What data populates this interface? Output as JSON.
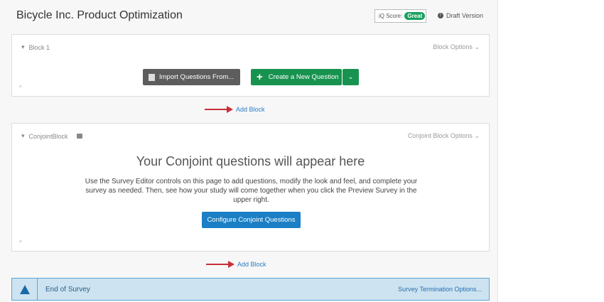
{
  "header": {
    "title": "Bicycle Inc. Product Optimization",
    "iq_label": "iQ Score:",
    "iq_value": "Great",
    "draft": "Draft Version"
  },
  "block1": {
    "name": "Block 1",
    "options": "Block Options",
    "import": "Import Questions From...",
    "create": "Create a New Question"
  },
  "add_block": "Add Block",
  "conjoint": {
    "name": "ConjointBlock",
    "options": "Conjoint Block Options",
    "heading": "Your Conjoint questions will appear here",
    "body": "Use the Survey Editor controls on this page to add questions, modify the look and feel, and complete your survey as needed. Then, see how your study will come together when you click the Preview Survey in the upper right.",
    "button": "Configure Conjoint Questions"
  },
  "end": {
    "label": "End of Survey",
    "options": "Survey Termination Options..."
  }
}
